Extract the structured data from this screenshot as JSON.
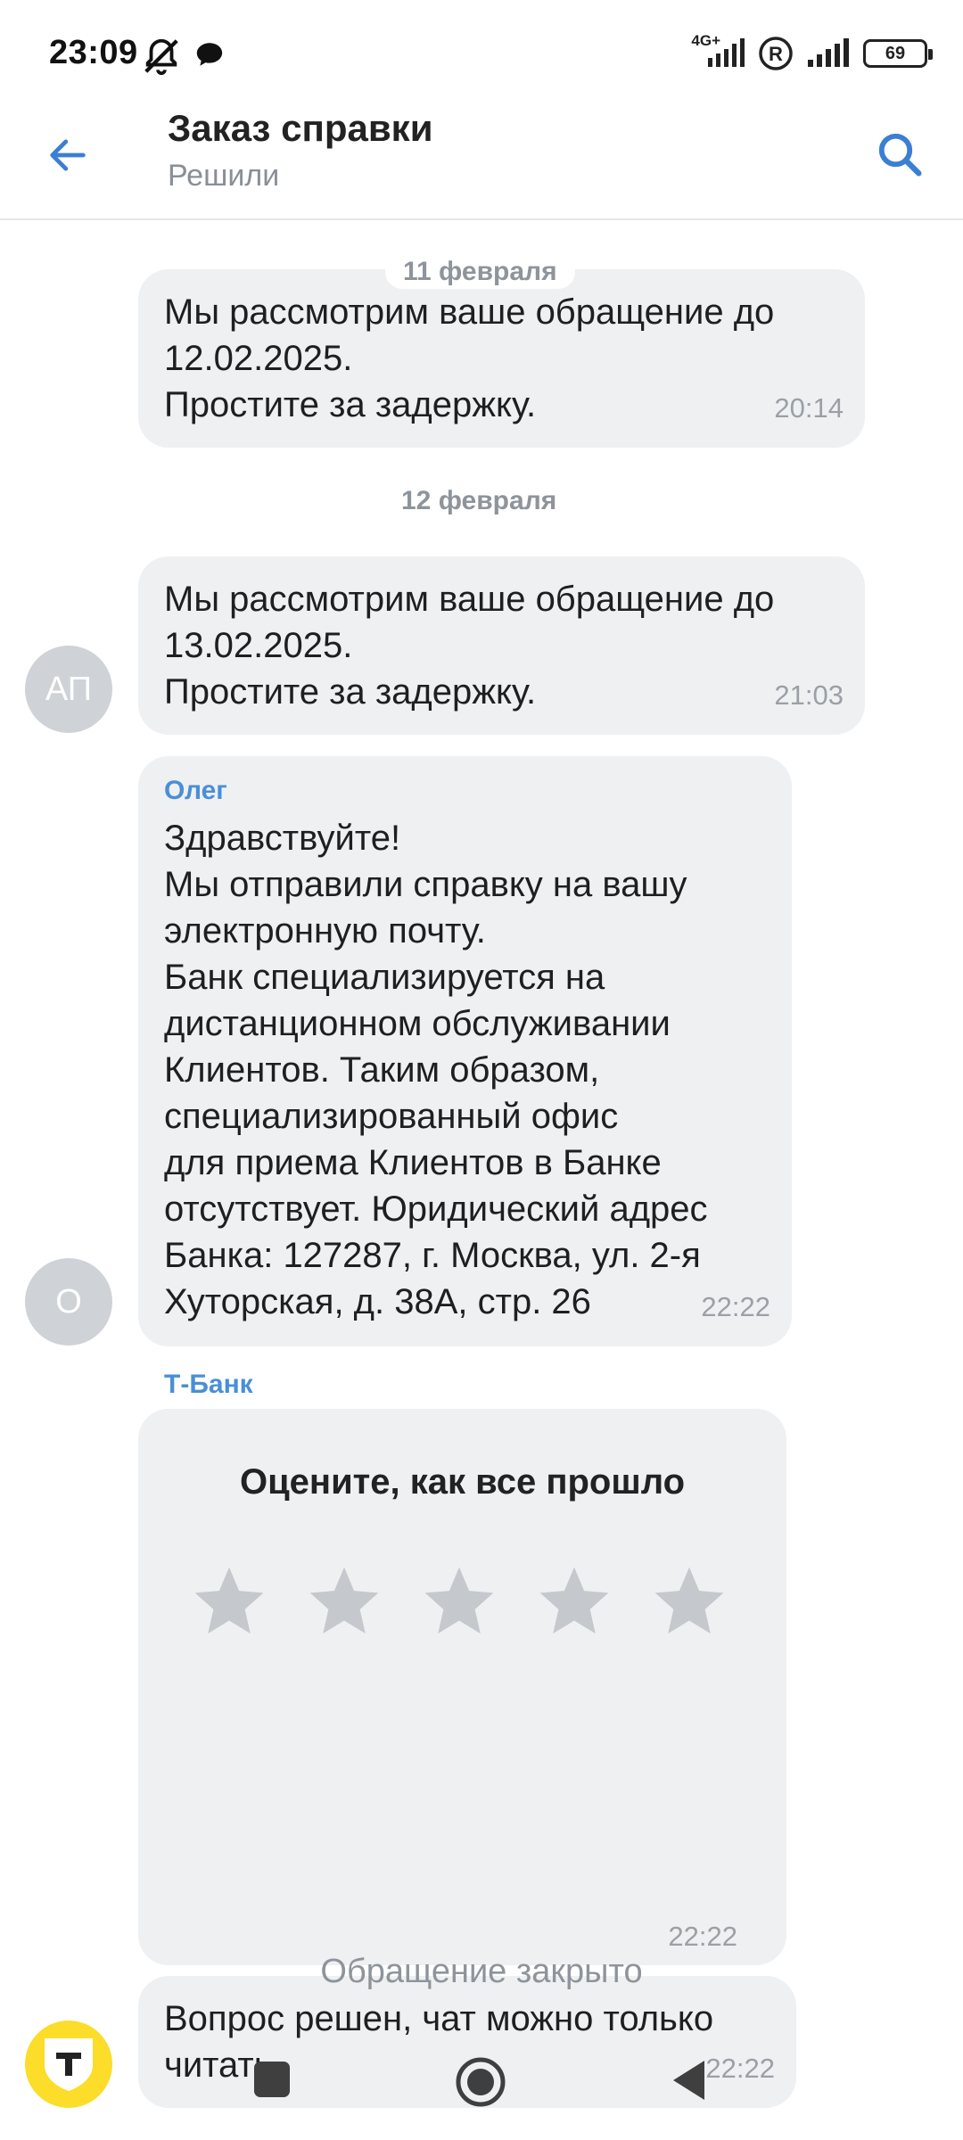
{
  "status_bar": {
    "time": "23:09",
    "network": "4G+",
    "battery": "69",
    "icons": [
      "mute-icon",
      "chat-bubble-icon",
      "signal-icon",
      "roaming-r-icon",
      "signal-icon",
      "battery-icon"
    ]
  },
  "header": {
    "title": "Заказ справки",
    "subtitle": "Решили",
    "accent": "#3b7fd4"
  },
  "chat": {
    "date_1": "11 февраля",
    "msg_1": {
      "text": "Мы рассмотрим ваше обращение до\n12.02.2025.\nПростите за задержку.",
      "time": "20:14"
    },
    "date_2": "12 февраля",
    "msg_2": {
      "avatar": "АП",
      "text": "Мы рассмотрим ваше обращение до\n13.02.2025.\nПростите за задержку.",
      "time": "21:03"
    },
    "msg_3": {
      "avatar": "О",
      "sender": "Олег",
      "text": "Здравствуйте!\nМы отправили справку на вашу\nэлектронную почту.\nБанк специализируется на\nдистанционном обслуживании\nКлиентов. Таким образом,\nспециализированный офис\nдля приема Клиентов в Банке\nотсутствует. Юридический адрес\nБанка: 127287, г. Москва, ул. 2-я\nХуторская, д. 38А, стр. 26",
      "time": "22:22"
    },
    "rating": {
      "sender": "Т-Банк",
      "title": "Оцените, как все прошло",
      "time": "22:22",
      "stars_total": 5,
      "stars_selected": 0
    },
    "msg_4": {
      "text": "Вопрос решен, чат можно только\nчитать",
      "time": "22:22"
    },
    "closed_label": "Обращение закрыто"
  }
}
